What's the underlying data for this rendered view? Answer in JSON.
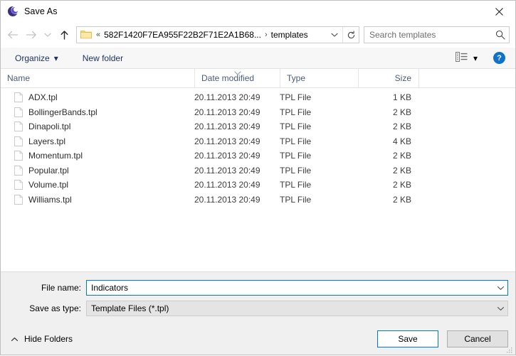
{
  "window": {
    "title": "Save As",
    "app_icon": "metatrader-moon-icon",
    "close_label": "✕"
  },
  "nav": {
    "back_icon": "arrow-left-icon",
    "forward_icon": "arrow-right-icon",
    "recent_icon": "chevron-down-icon",
    "up_icon": "arrow-up-icon",
    "address": {
      "folder_icon": "folder-icon",
      "leading_separator": "«",
      "crumbs": [
        "582F1420F7EA955F22B2F71E2A1B68...",
        "templates"
      ],
      "separator": "›",
      "dropdown_icon": "chevron-down-icon",
      "refresh_icon": "refresh-icon"
    },
    "search": {
      "placeholder": "Search templates",
      "value": "",
      "icon": "search-icon"
    }
  },
  "toolbar": {
    "organize_label": "Organize",
    "organize_caret": "▾",
    "new_folder_label": "New folder",
    "view_icon": "view-list-icon",
    "view_caret": "▾",
    "help_label": "?"
  },
  "columns": {
    "name": "Name",
    "date_modified": "Date modified",
    "type": "Type",
    "size": "Size",
    "sort_indicator": "⌄",
    "sorted_by": "date_modified"
  },
  "files": [
    {
      "icon": "file-icon",
      "name": "ADX.tpl",
      "date": "20.11.2013 20:49",
      "type": "TPL File",
      "size": "1 KB"
    },
    {
      "icon": "file-icon",
      "name": "BollingerBands.tpl",
      "date": "20.11.2013 20:49",
      "type": "TPL File",
      "size": "2 KB"
    },
    {
      "icon": "file-icon",
      "name": "Dinapoli.tpl",
      "date": "20.11.2013 20:49",
      "type": "TPL File",
      "size": "2 KB"
    },
    {
      "icon": "file-icon",
      "name": "Layers.tpl",
      "date": "20.11.2013 20:49",
      "type": "TPL File",
      "size": "4 KB"
    },
    {
      "icon": "file-icon",
      "name": "Momentum.tpl",
      "date": "20.11.2013 20:49",
      "type": "TPL File",
      "size": "2 KB"
    },
    {
      "icon": "file-icon",
      "name": "Popular.tpl",
      "date": "20.11.2013 20:49",
      "type": "TPL File",
      "size": "2 KB"
    },
    {
      "icon": "file-icon",
      "name": "Volume.tpl",
      "date": "20.11.2013 20:49",
      "type": "TPL File",
      "size": "2 KB"
    },
    {
      "icon": "file-icon",
      "name": "Williams.tpl",
      "date": "20.11.2013 20:49",
      "type": "TPL File",
      "size": "2 KB"
    }
  ],
  "form": {
    "filename_label": "File name:",
    "filename_value": "Indicators",
    "filetype_label": "Save as type:",
    "filetype_value": "Template Files (*.tpl)",
    "dropdown_icon": "chevron-down-icon"
  },
  "footer": {
    "hide_folders_label": "Hide Folders",
    "hide_folders_icon": "chevron-up-icon",
    "save_label": "Save",
    "cancel_label": "Cancel",
    "resize_grip": "resize-grip-icon"
  },
  "colors": {
    "accent": "#0078d7",
    "toolbar_text": "#1d3461",
    "column_header_text": "#4a5b78",
    "panel_bg": "#f0f0f0",
    "toolbar_bg": "#f7f7f7",
    "help_blue": "#1272c8",
    "folder_yellow": "#fcd975"
  }
}
